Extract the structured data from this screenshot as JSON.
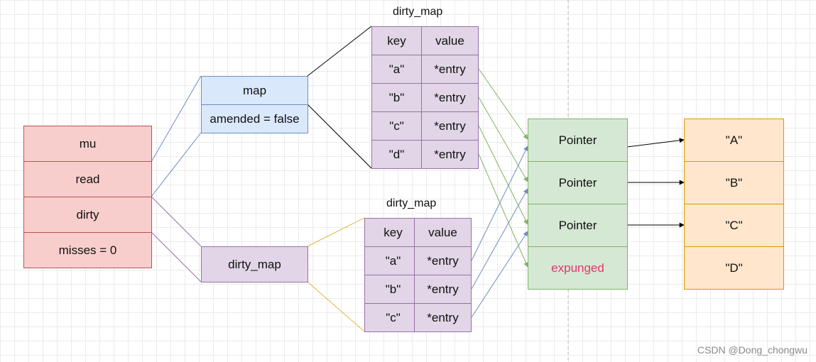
{
  "struct": {
    "fields": [
      "mu",
      "read",
      "dirty",
      "misses =  0"
    ]
  },
  "read_node": {
    "map_label": "map",
    "amended_label": "amended = false"
  },
  "dirty_node": {
    "label": "dirty_map"
  },
  "map_top": {
    "title": "dirty_map",
    "headers": [
      "key",
      "value"
    ],
    "rows": [
      [
        "\"a\"",
        "*entry"
      ],
      [
        "\"b\"",
        "*entry"
      ],
      [
        "\"c\"",
        "*entry"
      ],
      [
        "\"d\"",
        "*entry"
      ]
    ]
  },
  "map_bottom": {
    "title": "dirty_map",
    "headers": [
      "key",
      "value"
    ],
    "rows": [
      [
        "\"a\"",
        "*entry"
      ],
      [
        "\"b\"",
        "*entry"
      ],
      [
        "\"c\"",
        "*entry"
      ]
    ]
  },
  "pointers": [
    "Pointer",
    "Pointer",
    "Pointer",
    "expunged"
  ],
  "values": [
    "\"A\"",
    "\"B\"",
    "\"C\"",
    "\"D\""
  ],
  "watermark": "CSDN @Dong_chongwu",
  "colors": {
    "red_fill": "#f8cecc",
    "blue_fill": "#dae8fc",
    "purple_fill": "#e1d5e7",
    "green_fill": "#d5e8d4",
    "orange_fill": "#ffe6cc",
    "green_arrow": "#82b366",
    "blue_arrow": "#6c8ebf",
    "expunged_text": "#e8336e"
  }
}
